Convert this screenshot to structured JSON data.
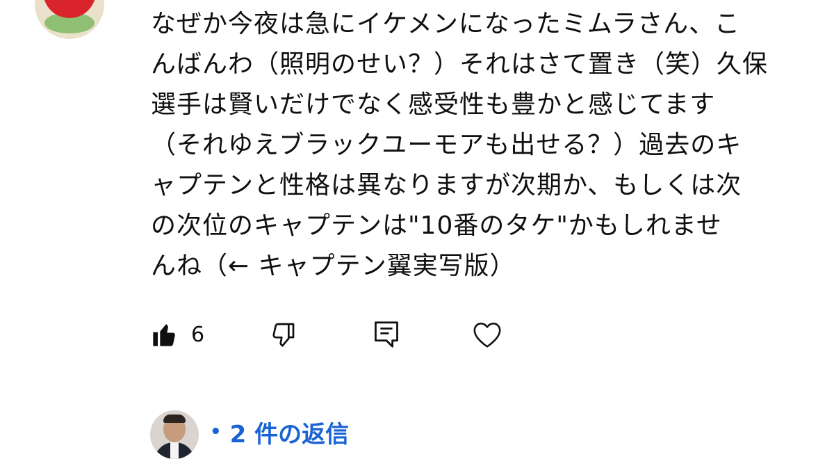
{
  "comment": {
    "lines": [
      "なぜか今夜は急にイケメンになったミムラさん、こ",
      "んばんわ（照明のせい？）それはさて置き（笑）久保",
      "選手は賢いだけでなく感受性も豊かと感じてます",
      "（それゆえブラックユーモアも出せる？）過去のキ",
      "ャプテンと性格は異なりますが次期か、もしくは次",
      "の次位のキャプテンは\"10番のタケ\"かもしれませ",
      "んね（← キャプテン翼実写版）"
    ]
  },
  "actions": {
    "like_count": "6",
    "like_icon": "thumbs-up-filled-icon",
    "dislike_icon": "thumbs-down-outline-icon",
    "reply_icon": "comment-reply-icon",
    "heart_icon": "heart-outline-icon"
  },
  "replies": {
    "dot": "•",
    "label": "2 件の返信",
    "color": "#1a63d6"
  }
}
